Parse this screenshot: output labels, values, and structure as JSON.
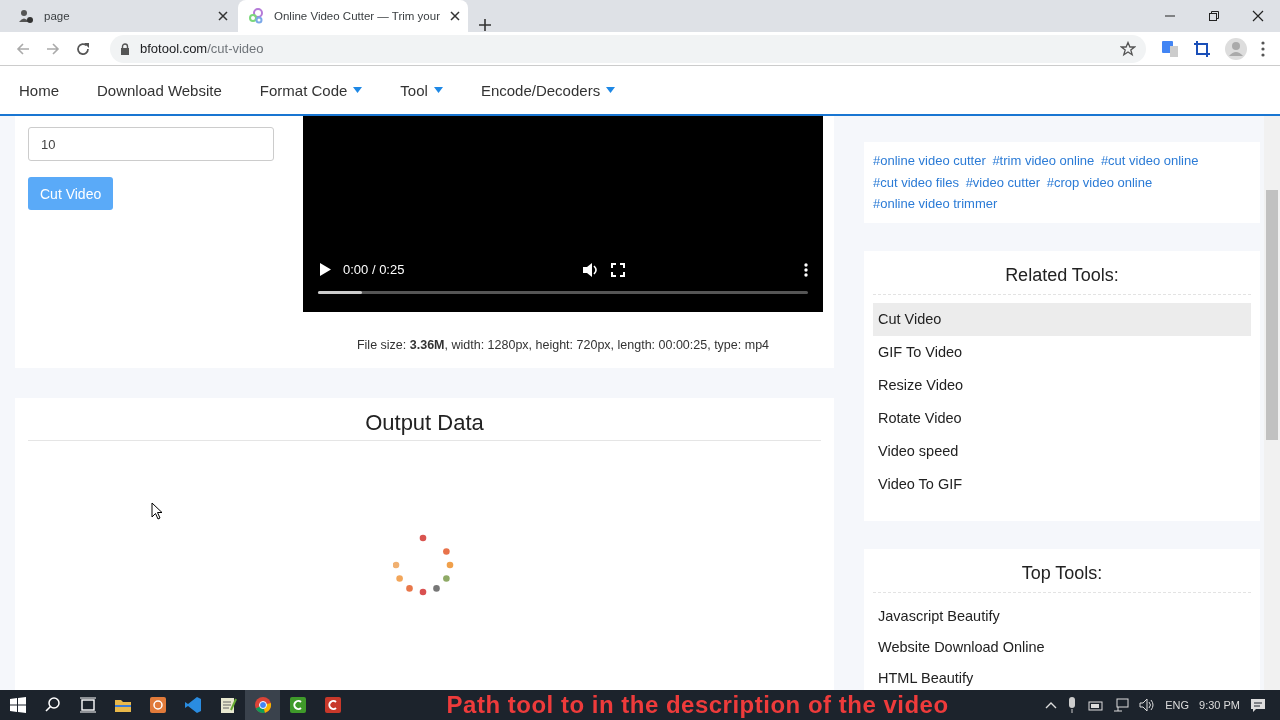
{
  "browser": {
    "tabs": [
      {
        "title": "page",
        "selected": false
      },
      {
        "title": "Online Video Cutter — Trim your",
        "selected": true
      }
    ],
    "url": {
      "host": "bfotool.com",
      "path": "/cut-video"
    }
  },
  "nav": [
    {
      "label": "Home",
      "dropdown": false
    },
    {
      "label": "Download Website",
      "dropdown": false
    },
    {
      "label": "Format Code",
      "dropdown": true
    },
    {
      "label": "Tool",
      "dropdown": true
    },
    {
      "label": "Encode/Decoders",
      "dropdown": true
    }
  ],
  "cutter": {
    "field_value": "10",
    "button": "Cut Video",
    "video": {
      "time": "0:00 / 0:25",
      "level": 0.09
    },
    "file_info": "File size: **3.36M**, width: 1280px, height: 720px, length: 00:00:25, type: mp4"
  },
  "output": {
    "title": "Output Data"
  },
  "tags": [
    "#online video cutter",
    "#trim video online",
    "#cut video online",
    "#cut video files",
    "#video cutter",
    "#crop video online",
    "#online video trimmer"
  ],
  "related_tools": {
    "title": "Related Tools:",
    "items": [
      {
        "label": "Cut Video",
        "selected": true
      },
      {
        "label": "GIF To Video",
        "selected": false
      },
      {
        "label": "Resize Video",
        "selected": false
      },
      {
        "label": "Rotate Video",
        "selected": false
      },
      {
        "label": "Video speed",
        "selected": false
      },
      {
        "label": "Video To GIF",
        "selected": false
      }
    ]
  },
  "top_tools": {
    "title": "Top Tools:",
    "items": [
      "Javascript Beautify",
      "Website Download Online",
      "HTML Beautify"
    ]
  },
  "taskbar": {
    "caption": "Path tool to in the description of the video",
    "language": "ENG",
    "time": "9:30 PM"
  }
}
